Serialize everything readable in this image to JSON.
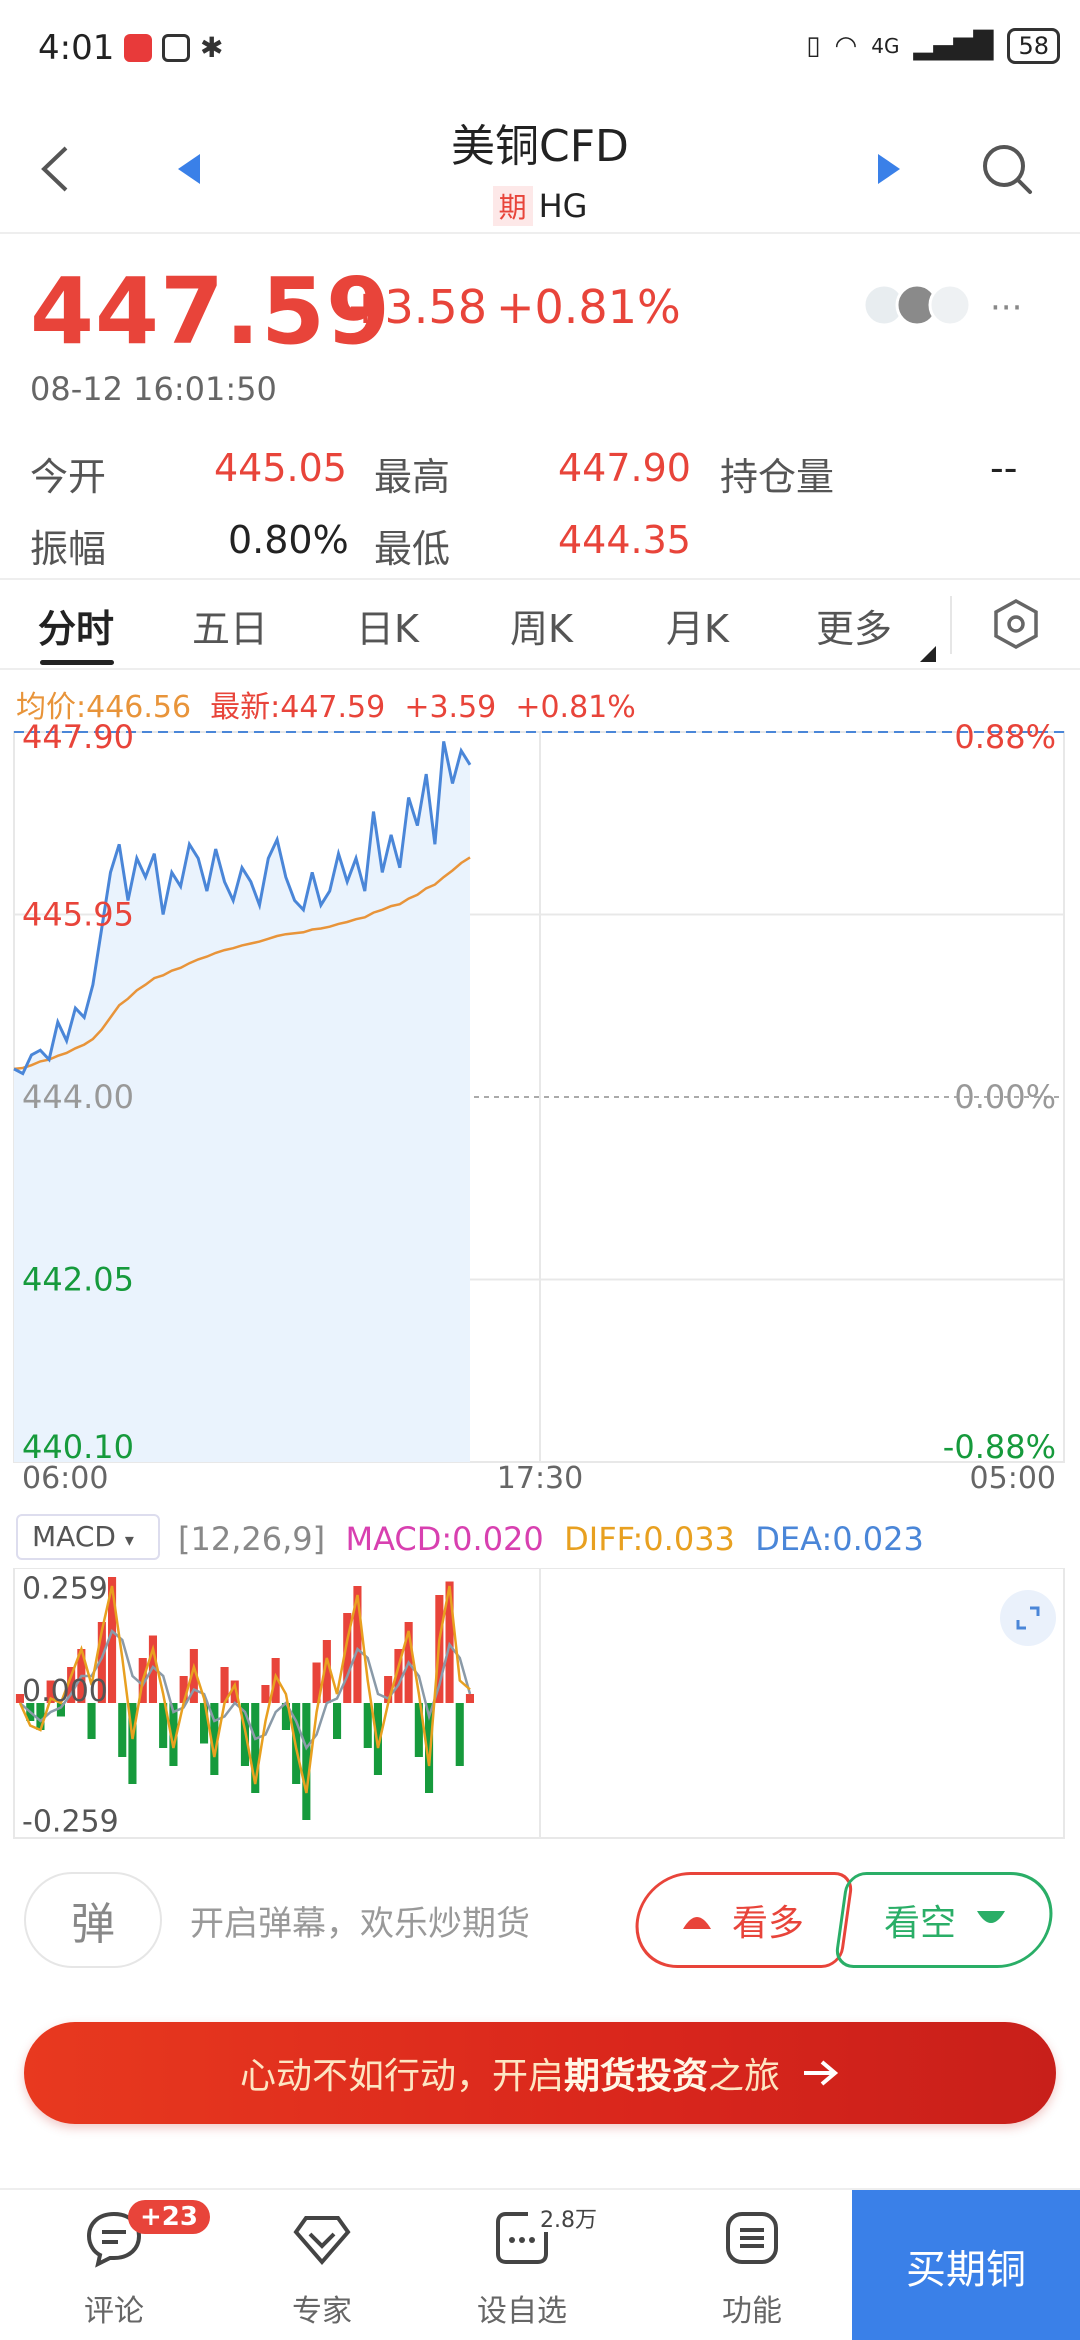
{
  "status_bar": {
    "time": "4:01",
    "network": "4G",
    "battery": "58"
  },
  "header": {
    "title": "美铜CFD",
    "tag": "期",
    "code": "HG"
  },
  "quote": {
    "price": "447.59",
    "change": "+3.58",
    "change_pct": "+0.81%",
    "timestamp": "08-12 16:01:50"
  },
  "stats": [
    {
      "label": "今开",
      "value": "445.05"
    },
    {
      "label": "最高",
      "value": "447.90"
    },
    {
      "label": "持仓量",
      "value": "--"
    },
    {
      "label": "振幅",
      "value": "0.80%"
    },
    {
      "label": "最低",
      "value": "444.35"
    }
  ],
  "tabs": [
    "分时",
    "五日",
    "日K",
    "周K",
    "月K",
    "更多"
  ],
  "info_row": {
    "avg": "均价:446.56",
    "latest": "最新:447.59",
    "change": "+3.59",
    "pct": "+0.81%"
  },
  "chart_data": [
    {
      "type": "line",
      "title": "",
      "y_ticks": [
        "447.90",
        "445.95",
        "444.00",
        "442.05",
        "440.10"
      ],
      "pct_ticks": [
        "0.88%",
        "0.00%",
        "-0.88%"
      ],
      "x_ticks": [
        "06:00",
        "17:30",
        "05:00"
      ],
      "ylim": [
        440.1,
        447.9
      ],
      "prev_close": 444.0,
      "series": [
        {
          "name": "最新",
          "values": [
            444.3,
            444.25,
            444.45,
            444.5,
            444.4,
            444.8,
            444.6,
            444.95,
            444.85,
            445.2,
            445.8,
            446.4,
            446.7,
            446.1,
            446.55,
            446.35,
            446.6,
            445.95,
            446.4,
            446.25,
            446.7,
            446.55,
            446.2,
            446.65,
            446.3,
            446.1,
            446.45,
            446.3,
            446.05,
            446.55,
            446.75,
            446.35,
            446.1,
            446.0,
            446.4,
            446.05,
            446.2,
            446.6,
            446.3,
            446.55,
            446.2,
            447.05,
            446.4,
            446.8,
            446.45,
            447.2,
            446.9,
            447.45,
            446.7,
            447.8,
            447.35,
            447.7,
            447.55
          ]
        },
        {
          "name": "均价",
          "values": [
            444.3,
            444.31,
            444.34,
            444.38,
            444.4,
            444.44,
            444.47,
            444.52,
            444.56,
            444.62,
            444.72,
            444.85,
            444.98,
            445.05,
            445.14,
            445.2,
            445.27,
            445.3,
            445.35,
            445.38,
            445.43,
            445.47,
            445.5,
            445.54,
            445.57,
            445.59,
            445.62,
            445.64,
            445.66,
            445.69,
            445.72,
            445.74,
            445.75,
            445.76,
            445.79,
            445.8,
            445.82,
            445.85,
            445.87,
            445.9,
            445.92,
            445.97,
            446.0,
            446.04,
            446.06,
            446.12,
            446.16,
            446.23,
            446.27,
            446.35,
            446.42,
            446.5,
            446.56
          ]
        }
      ]
    },
    {
      "type": "bar",
      "title": "MACD",
      "params": "[12,26,9]",
      "macd_label": "MACD:0.020",
      "diff_label": "DIFF:0.033",
      "dea_label": "DEA:0.023",
      "y_ticks": [
        "0.259",
        "0.000",
        "-0.259"
      ],
      "ylim": [
        -0.3,
        0.3
      ],
      "macd": [
        0.02,
        -0.04,
        -0.06,
        0.05,
        -0.03,
        0.08,
        0.12,
        -0.08,
        0.18,
        0.28,
        -0.12,
        -0.18,
        0.1,
        0.15,
        -0.1,
        -0.14,
        0.06,
        0.12,
        -0.09,
        -0.16,
        0.08,
        0.05,
        -0.14,
        -0.2,
        0.04,
        0.1,
        -0.06,
        -0.18,
        -0.26,
        0.09,
        0.14,
        -0.08,
        0.2,
        0.26,
        -0.1,
        -0.16,
        0.06,
        0.12,
        0.18,
        -0.12,
        -0.2,
        0.24,
        0.27,
        -0.14,
        0.02
      ],
      "diff": [
        0.0,
        -0.05,
        -0.06,
        0.01,
        0.0,
        0.06,
        0.12,
        0.04,
        0.16,
        0.26,
        0.1,
        -0.08,
        0.05,
        0.12,
        0.02,
        -0.1,
        0.0,
        0.08,
        0.01,
        -0.12,
        0.0,
        0.04,
        -0.06,
        -0.18,
        -0.04,
        0.06,
        0.02,
        -0.1,
        -0.2,
        -0.02,
        0.1,
        0.02,
        0.14,
        0.24,
        0.05,
        -0.1,
        0.0,
        0.08,
        0.16,
        0.02,
        -0.14,
        0.14,
        0.26,
        0.05,
        0.03
      ],
      "dea": [
        0.0,
        -0.02,
        -0.04,
        -0.02,
        -0.01,
        0.02,
        0.06,
        0.06,
        0.1,
        0.16,
        0.14,
        0.06,
        0.04,
        0.08,
        0.06,
        -0.02,
        -0.01,
        0.03,
        0.02,
        -0.04,
        -0.03,
        0.0,
        -0.02,
        -0.08,
        -0.07,
        -0.02,
        0.0,
        -0.04,
        -0.1,
        -0.07,
        0.0,
        0.01,
        0.06,
        0.12,
        0.1,
        0.02,
        0.01,
        0.04,
        0.09,
        0.06,
        -0.03,
        0.04,
        0.13,
        0.1,
        0.02
      ]
    }
  ],
  "danmaku": {
    "button": "弹",
    "text": "开启弹幕，欢乐炒期货",
    "bull": "看多",
    "bear": "看空"
  },
  "banner": {
    "pre": "心动不如行动，开启",
    "bold": "期货投资",
    "post": "之旅"
  },
  "bottom_nav": [
    {
      "label": "评论",
      "badge": "+23"
    },
    {
      "label": "专家"
    },
    {
      "label": "设自选",
      "badge": "2.8万"
    },
    {
      "label": "功能"
    }
  ],
  "buy_label": "买期铜",
  "colors": {
    "up": "#e8443a",
    "down": "#169a3c",
    "line": "#4a86d8",
    "avg": "#e8943a",
    "macd_pink": "#d840b0",
    "diff_orange": "#e8a020",
    "dea_blue": "#4a86d8"
  }
}
